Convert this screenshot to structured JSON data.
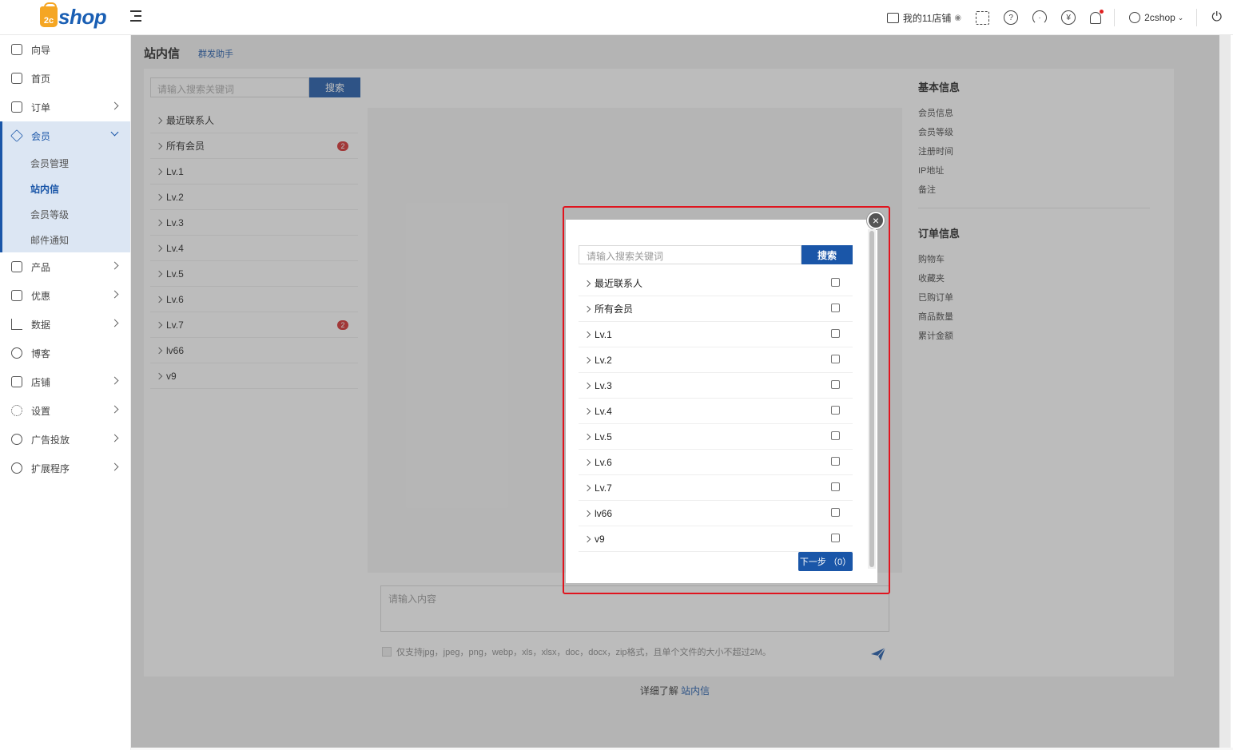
{
  "brand": {
    "logo_mark": "2c",
    "logo_text": "shop"
  },
  "header": {
    "store_label": "我的11店铺",
    "user_label": "2cshop",
    "icons": [
      "store-icon",
      "eye-icon",
      "qrcode-icon",
      "help-icon",
      "headset-icon",
      "yen-icon",
      "bell-icon",
      "user-icon",
      "power-icon"
    ]
  },
  "sidebar": {
    "items": [
      {
        "label": "向导",
        "icon": "guide-icon"
      },
      {
        "label": "首页",
        "icon": "home-icon"
      },
      {
        "label": "订单",
        "icon": "order-icon"
      },
      {
        "label": "会员",
        "icon": "member-icon"
      },
      {
        "label": "产品",
        "icon": "product-icon"
      },
      {
        "label": "优惠",
        "icon": "tag-icon"
      },
      {
        "label": "数据",
        "icon": "chart-icon"
      },
      {
        "label": "博客",
        "icon": "blog-icon"
      },
      {
        "label": "店铺",
        "icon": "store-icon"
      },
      {
        "label": "设置",
        "icon": "settings-icon"
      },
      {
        "label": "广告投放",
        "icon": "ads-icon"
      },
      {
        "label": "扩展程序",
        "icon": "extension-icon"
      }
    ],
    "member_sub": [
      "会员管理",
      "站内信",
      "会员等级",
      "邮件通知"
    ]
  },
  "page": {
    "title": "站内信",
    "link": "群发助手",
    "search_placeholder": "请输入搜索关键词",
    "search_button": "搜索",
    "groups": [
      {
        "label": "最近联系人",
        "badge": ""
      },
      {
        "label": "所有会员",
        "badge": "2"
      },
      {
        "label": "Lv.1",
        "badge": ""
      },
      {
        "label": "Lv.2",
        "badge": ""
      },
      {
        "label": "Lv.3",
        "badge": ""
      },
      {
        "label": "Lv.4",
        "badge": ""
      },
      {
        "label": "Lv.5",
        "badge": ""
      },
      {
        "label": "Lv.6",
        "badge": ""
      },
      {
        "label": "Lv.7",
        "badge": "2"
      },
      {
        "label": "lv66",
        "badge": ""
      },
      {
        "label": "v9",
        "badge": ""
      }
    ],
    "message_placeholder": "请输入内容",
    "upload_note": "仅支持jpg，jpeg，png，webp，xls，xlsx，doc，docx，zip格式，且单个文件的大小不超过2M。",
    "basic_info_title": "基本信息",
    "basic_info": [
      "会员信息",
      "会员等级",
      "注册时间",
      "IP地址",
      "备注"
    ],
    "order_info_title": "订单信息",
    "order_info": [
      "购物车",
      "收藏夹",
      "已购订单",
      "商品数量",
      "累计金额"
    ],
    "footer_prefix": "详细了解 ",
    "footer_link": "站内信"
  },
  "modal": {
    "search_placeholder": "请输入搜索关键词",
    "search_button": "搜索",
    "items": [
      "最近联系人",
      "所有会员",
      "Lv.1",
      "Lv.2",
      "Lv.3",
      "Lv.4",
      "Lv.5",
      "Lv.6",
      "Lv.7",
      "lv66",
      "v9"
    ],
    "next_button": "下一步 （0）",
    "close_symbol": "×"
  },
  "colors": {
    "primary": "#1a56a8",
    "badge": "#d42a2a",
    "highlight_frame": "#e0141e",
    "logo_orange": "#f5a623"
  }
}
